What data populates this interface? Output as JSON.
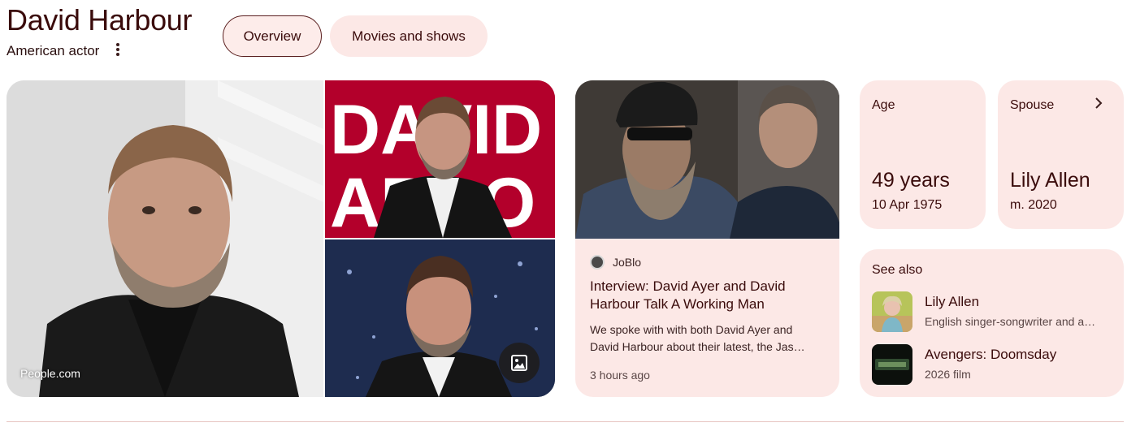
{
  "header": {
    "title": "David Harbour",
    "subtitle": "American actor"
  },
  "tabs": [
    {
      "label": "Overview"
    },
    {
      "label": "Movies and shows"
    }
  ],
  "gallery": {
    "source": "People.com",
    "icons": [
      "image-gallery-icon"
    ]
  },
  "news": {
    "source": "JoBlo",
    "title": "Interview: David Ayer and David Harbour Talk A Working Man",
    "snippet_line1": "We spoke with with both David Ayer and",
    "snippet_line2": "David Harbour about their latest, the Jas…",
    "time": "3 hours ago"
  },
  "facts": {
    "age": {
      "label": "Age",
      "value": "49 years",
      "sub": "10 Apr 1975"
    },
    "spouse": {
      "label": "Spouse",
      "value": "Lily Allen",
      "sub": "m. 2020"
    }
  },
  "see_also": {
    "title": "See also",
    "items": [
      {
        "name": "Lily Allen",
        "desc": "English singer-songwriter and a…"
      },
      {
        "name": "Avengers: Doomsday",
        "desc": "2026 film"
      }
    ]
  },
  "colors": {
    "accent_bg": "#fce8e6",
    "text_dark": "#3a0b0b"
  }
}
